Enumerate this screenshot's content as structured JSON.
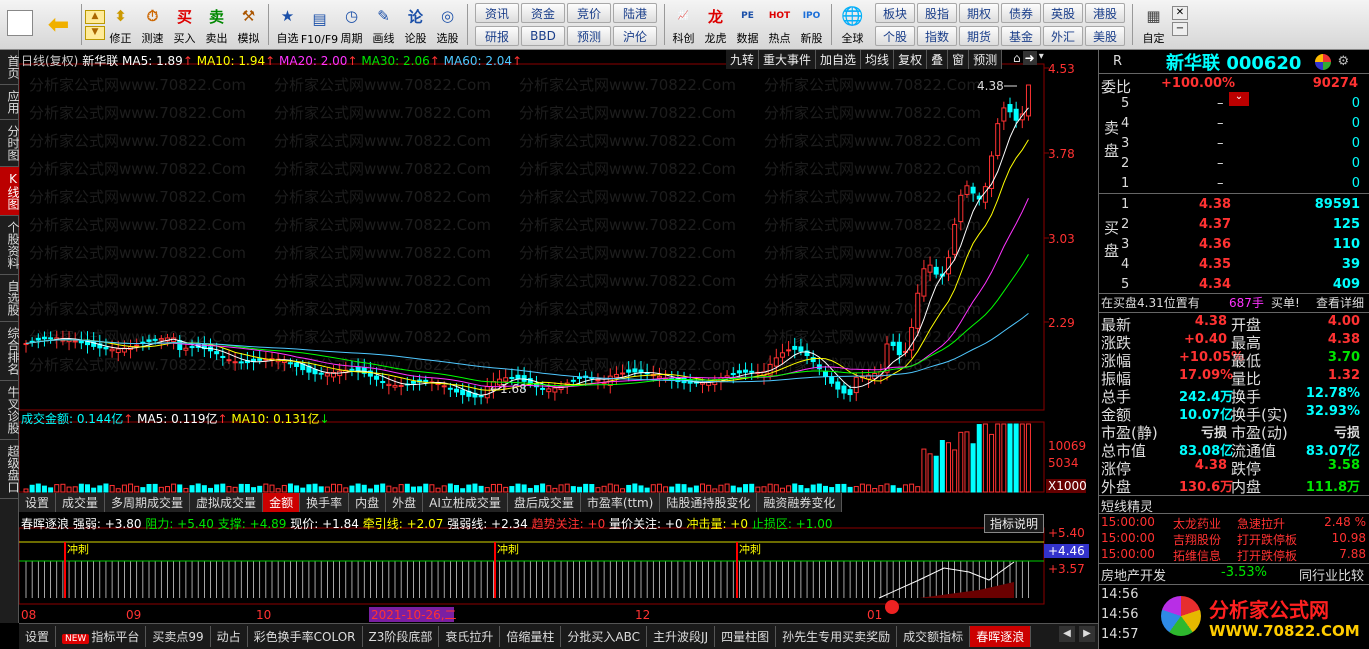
{
  "toolbar": {
    "nav": [
      {
        "label": "",
        "icon": "color-grid-icon"
      },
      {
        "label": "",
        "icon": "arrow-left-icon"
      }
    ],
    "main": [
      {
        "label": "修正",
        "icon": "updown-icon"
      },
      {
        "label": "测速",
        "icon": "speed-icon"
      },
      {
        "label": "买入",
        "icon": "buy-icon"
      },
      {
        "label": "卖出",
        "icon": "sell-icon"
      },
      {
        "label": "模拟",
        "icon": "hammer-icon"
      }
    ],
    "main2": [
      {
        "label": "自选",
        "icon": "star-icon"
      },
      {
        "label": "F10/F9",
        "icon": "f10-icon"
      },
      {
        "label": "周期",
        "icon": "clock-icon"
      },
      {
        "label": "画线",
        "icon": "pen-icon"
      },
      {
        "label": "论股",
        "icon": "forum-icon"
      },
      {
        "label": "选股",
        "icon": "select-icon"
      }
    ],
    "grid1": [
      "资讯",
      "资金",
      "竞价",
      "研报",
      "BBD",
      "预测"
    ],
    "grid1b": [
      "陆港",
      "沪伦"
    ],
    "main3": [
      {
        "label": "科创",
        "icon": "kechuang-icon"
      },
      {
        "label": "龙虎",
        "icon": "dragon-icon"
      },
      {
        "label": "数据",
        "icon": "pe-icon"
      },
      {
        "label": "热点",
        "icon": "hot-icon"
      },
      {
        "label": "新股",
        "icon": "ipo-icon"
      }
    ],
    "globe": {
      "label": "全球",
      "icon": "globe-icon"
    },
    "grid2": [
      "板块",
      "股指",
      "期权",
      "债券",
      "英股",
      "港股",
      "个股",
      "指数",
      "期货",
      "基金",
      "外汇",
      "美股"
    ],
    "custom": {
      "label": "自定",
      "icon": "custom-icon"
    }
  },
  "leftnav": [
    "首页",
    "应用",
    "分时图",
    "K线图",
    "个股资料",
    "自选股",
    "综合排名",
    "牛叉诊股",
    "超级盘口"
  ],
  "leftnav_active": 3,
  "kline": {
    "header": {
      "period": "日线(复权)",
      "name": "新华联",
      "ma5": "MA5: 1.89",
      "ma10": "MA10: 1.94",
      "ma20": "MA20: 2.00",
      "ma30": "MA30: 2.06",
      "ma60": "MA60: 2.04"
    },
    "top_buttons": [
      "九转",
      "重大事件",
      "加自选",
      "均线",
      "复权",
      "叠",
      "窗",
      "预测"
    ],
    "price_axis": [
      "4.53",
      "3.78",
      "3.03",
      "2.29"
    ],
    "high_label": "4.38",
    "low_label": "1.68",
    "watermark": "分析家公式网www.70822.Com"
  },
  "volume": {
    "header": {
      "title": "成交金额: 0.144亿",
      "ma5": "MA5: 0.119亿",
      "ma10": "MA10: 0.131亿"
    },
    "axis": [
      "10069",
      "5034",
      "X1000"
    ],
    "tabs": [
      "设置",
      "成交量",
      "多周期成交量",
      "虚拟成交量",
      "金额",
      "换手率",
      "内盘",
      "外盘",
      "AI立桩成交量",
      "盘后成交量",
      "市盈率(ttm)",
      "陆股通持股变化",
      "融资融券变化"
    ],
    "active_tab": 4
  },
  "indicator": {
    "header": {
      "name": "春晖逐浪",
      "qr": "强弱: +3.80",
      "zl": "阻力: +5.40",
      "zc": "支撑: +4.89",
      "xj": "现价: +1.84",
      "qy": "牵引线: +2.07",
      "qrx": "强弱线: +2.34",
      "qsgz": "趋势关注: +0",
      "ljgz": "量价关注: +0",
      "cjl": "冲击量: +0",
      "zsq": "止损区: +1.00"
    },
    "help": "指标说明",
    "axis": [
      "+5.40",
      "+4.46",
      "+3.57"
    ],
    "markers": [
      "冲刺",
      "冲刺",
      "冲刺"
    ]
  },
  "xaxis": [
    "08",
    "09",
    "10",
    "2021-10-26,二",
    "12",
    "01"
  ],
  "bottom_tabs": [
    "设置",
    "指标平台",
    "买卖点99",
    "动占",
    "彩色换手率COLOR",
    "Z3阶段底部",
    "衰氏拉升",
    "倍缩量柱",
    "分批买入ABC",
    "主升波段JJ",
    "四量柱图",
    "孙先生专用买卖奖励",
    "成交额指标",
    "春晖逐浪"
  ],
  "bottom_new": "NEW",
  "bottom_active": 13,
  "quote": {
    "title": "新华联 000620",
    "wb_label": "委比",
    "wb": "+100.00%",
    "wc": "90274",
    "sell_label": "卖盘",
    "buy_label": "买盘",
    "sells": [
      {
        "n": "5",
        "p": "–",
        "v": "0"
      },
      {
        "n": "4",
        "p": "–",
        "v": "0"
      },
      {
        "n": "3",
        "p": "–",
        "v": "0"
      },
      {
        "n": "2",
        "p": "–",
        "v": "0"
      },
      {
        "n": "1",
        "p": "–",
        "v": "0"
      }
    ],
    "buys": [
      {
        "n": "1",
        "p": "4.38",
        "v": "89591"
      },
      {
        "n": "2",
        "p": "4.37",
        "v": "125"
      },
      {
        "n": "3",
        "p": "4.36",
        "v": "110"
      },
      {
        "n": "4",
        "p": "4.35",
        "v": "39"
      },
      {
        "n": "5",
        "p": "4.34",
        "v": "409"
      }
    ],
    "zaimai": "在买盘4.31位置有",
    "zaimai_v": "687手",
    "zaimai_b": "买单!",
    "detail": "查看详细",
    "stats": [
      [
        "最新",
        "4.38",
        "开盘",
        "4.00"
      ],
      [
        "涨跌",
        "+0.40",
        "最高",
        "4.38"
      ],
      [
        "涨幅",
        "+10.05%",
        "最低",
        "3.70"
      ],
      [
        "振幅",
        "17.09%",
        "量比",
        "1.32"
      ],
      [
        "总手",
        "242.4万",
        "换手",
        "12.78%"
      ],
      [
        "金额",
        "10.07亿",
        "换手(实)",
        "32.93%"
      ],
      [
        "市盈(静)",
        "亏损",
        "市盈(动)",
        "亏损"
      ],
      [
        "总市值",
        "83.08亿",
        "流通值",
        "83.07亿"
      ],
      [
        "涨停",
        "4.38",
        "跌停",
        "3.58"
      ],
      [
        "外盘",
        "130.6万",
        "内盘",
        "111.8万"
      ]
    ],
    "dxjl": "短线精灵",
    "events": [
      [
        "15:00:00",
        "太龙药业",
        "急速拉升",
        "2.48 %"
      ],
      [
        "15:00:00",
        "吉翔股份",
        "打开跌停板",
        "10.98"
      ],
      [
        "15:00:00",
        "拓维信息",
        "打开跌停板",
        "7.88"
      ]
    ],
    "sector": "房地产开发",
    "sector_pct": "-3.53%",
    "sector_cmp": "同行业比较",
    "times": [
      "14:56",
      "14:56",
      "14:57"
    ],
    "logo": "分析家公式网",
    "logo_url": "WWW.70822.COM"
  },
  "colors": {
    "up": "#ff3232",
    "down": "#00ffff",
    "ma5": "#ffffff",
    "ma10": "#ffff00",
    "ma20": "#ff33ff",
    "ma30": "#00ff00",
    "ma60": "#4fc8ff"
  }
}
